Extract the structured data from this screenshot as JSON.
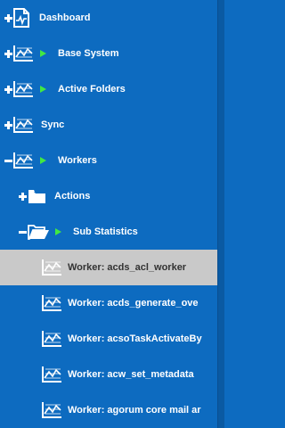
{
  "tree": {
    "items": [
      {
        "label": "Dashboard"
      },
      {
        "label": "Base System"
      },
      {
        "label": "Active Folders"
      },
      {
        "label": "Sync"
      },
      {
        "label": "Workers"
      },
      {
        "label": "Actions"
      },
      {
        "label": "Sub Statistics"
      },
      {
        "label": "Worker: acds_acl_worker"
      },
      {
        "label": "Worker: acds_generate_ove"
      },
      {
        "label": "Worker: acsoTaskActivateBy"
      },
      {
        "label": "Worker: acw_set_metadata"
      },
      {
        "label": "Worker: agorum core mail ar"
      }
    ]
  },
  "colors": {
    "background": "#0d6bc0",
    "selected": "#c9c9c9",
    "arrow": "#42e842",
    "text": "#ffffff"
  }
}
